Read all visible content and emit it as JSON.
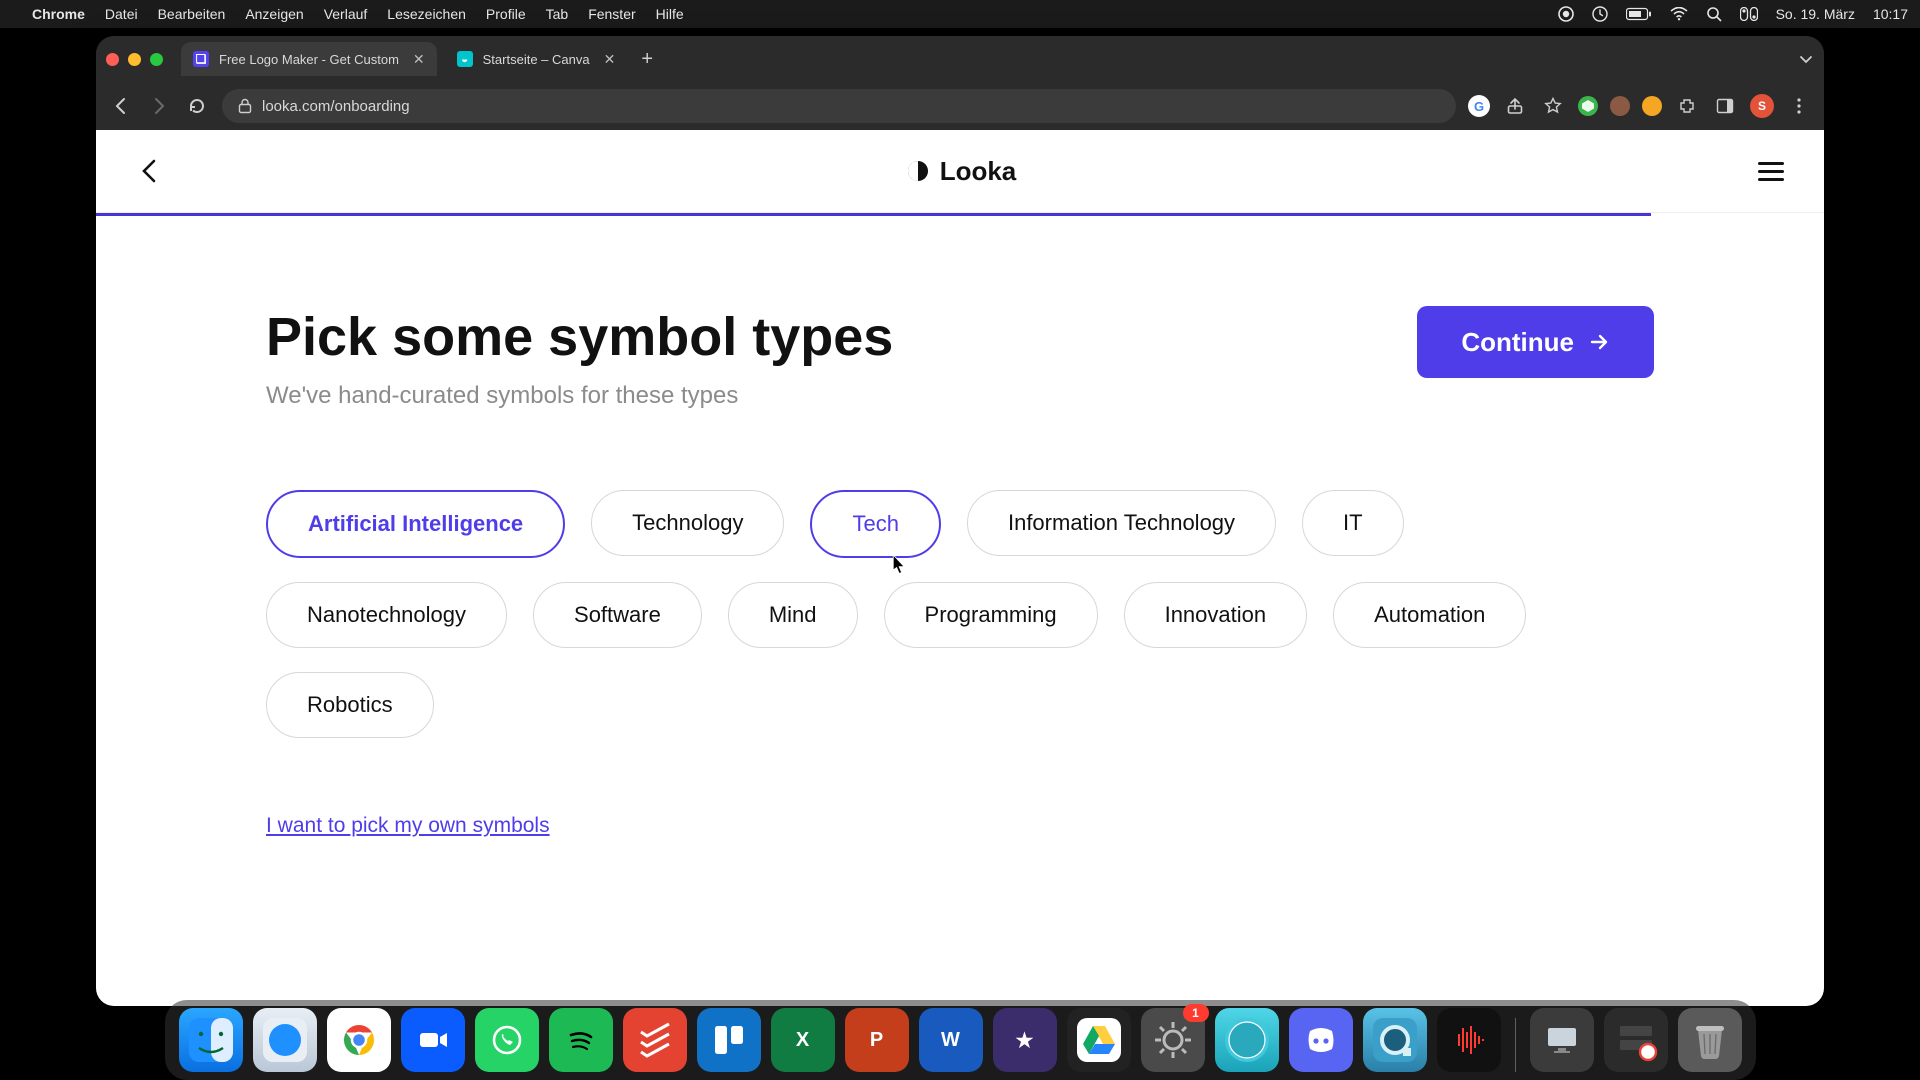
{
  "menubar": {
    "app": "Chrome",
    "items": [
      "Datei",
      "Bearbeiten",
      "Anzeigen",
      "Verlauf",
      "Lesezeichen",
      "Profile",
      "Tab",
      "Fenster",
      "Hilfe"
    ],
    "date": "So. 19. März",
    "time": "10:17"
  },
  "tabs": [
    {
      "title": "Free Logo Maker - Get Custom",
      "active": true
    },
    {
      "title": "Startseite – Canva",
      "active": false
    }
  ],
  "url": "looka.com/onboarding",
  "avatar_letter": "S",
  "page": {
    "brand": "Looka",
    "heading": "Pick some symbol types",
    "subtitle": "We've hand-curated symbols for these types",
    "continue_label": "Continue",
    "own_symbols_label": "I want to pick my own symbols",
    "chips": [
      {
        "label": "Artificial Intelligence",
        "state": "selected"
      },
      {
        "label": "Technology",
        "state": ""
      },
      {
        "label": "Tech",
        "state": "hover"
      },
      {
        "label": "Information Technology",
        "state": ""
      },
      {
        "label": "IT",
        "state": ""
      },
      {
        "label": "Nanotechnology",
        "state": ""
      },
      {
        "label": "Software",
        "state": ""
      },
      {
        "label": "Mind",
        "state": ""
      },
      {
        "label": "Programming",
        "state": ""
      },
      {
        "label": "Innovation",
        "state": ""
      },
      {
        "label": "Automation",
        "state": ""
      },
      {
        "label": "Robotics",
        "state": ""
      }
    ]
  },
  "dock": {
    "apps": [
      {
        "name": "finder",
        "bg": "linear-gradient(#2aa7ff,#0a6fe0)",
        "label": ""
      },
      {
        "name": "safari",
        "bg": "linear-gradient(#e8eef4,#b9c7d6)",
        "label": ""
      },
      {
        "name": "chrome",
        "bg": "#fff",
        "label": ""
      },
      {
        "name": "zoom",
        "bg": "#0b5cff",
        "label": ""
      },
      {
        "name": "whatsapp",
        "bg": "#25d366",
        "label": ""
      },
      {
        "name": "spotify",
        "bg": "#1db954",
        "label": ""
      },
      {
        "name": "todoist",
        "bg": "#e44332",
        "label": ""
      },
      {
        "name": "trello",
        "bg": "#1072c6",
        "label": ""
      },
      {
        "name": "excel",
        "bg": "#107c41",
        "label": "X"
      },
      {
        "name": "powerpoint",
        "bg": "#c43e1c",
        "label": "P"
      },
      {
        "name": "word",
        "bg": "#185abd",
        "label": "W"
      },
      {
        "name": "imovie",
        "bg": "#3b2d6b",
        "label": "★"
      },
      {
        "name": "drive",
        "bg": "#222",
        "label": ""
      },
      {
        "name": "settings",
        "bg": "#4a4a4a",
        "label": "",
        "badge": "1"
      },
      {
        "name": "globe",
        "bg": "linear-gradient(#4fd6e8,#1aa3b8)",
        "label": ""
      },
      {
        "name": "discord",
        "bg": "#5865f2",
        "label": ""
      },
      {
        "name": "quicktime",
        "bg": "linear-gradient(#59c2e8,#2a7fa8)",
        "label": ""
      },
      {
        "name": "audio",
        "bg": "#111",
        "label": ""
      }
    ],
    "right_apps": [
      {
        "name": "display",
        "bg": "#3b3b3b"
      },
      {
        "name": "dock-folder",
        "bg": "#2b2b2b"
      },
      {
        "name": "trash",
        "bg": "#5a5a5a"
      }
    ]
  }
}
